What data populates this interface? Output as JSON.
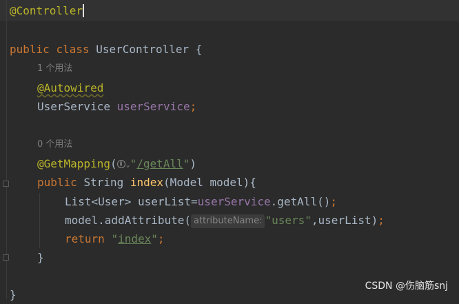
{
  "code": {
    "l1_annotation": "@Controller",
    "l3_public": "public",
    "l3_class": "class",
    "l3_name": "UserController",
    "l3_brace": "{",
    "usage_hint_1": "1 个用法",
    "l5_annotation": "@Autowired",
    "l6_type": "UserService",
    "l6_field": "userService",
    "l6_semi": ";",
    "usage_hint_2": "0 个用法",
    "l9_annotation": "@GetMapping",
    "l9_open": "(",
    "l9_quote_open": "\"",
    "l9_path": "/getAll",
    "l9_quote_close": "\"",
    "l9_close": ")",
    "l10_public": "public",
    "l10_type": "String",
    "l10_method": "index",
    "l10_params": "(Model model){",
    "l11_type": "List<User>",
    "l11_var": "userList=",
    "l11_field": "userService",
    "l11_call": ".getAll()",
    "l11_semi": ";",
    "l12_call": "model.addAttribute(",
    "l12_param_hint": "attributeName:",
    "l12_string": "\"users\"",
    "l12_rest": ",userList)",
    "l12_semi": ";",
    "l13_return": "return",
    "l13_quote_open": "\"",
    "l13_value": "index",
    "l13_quote_close": "\"",
    "l13_semi": ";",
    "l14_brace": "}",
    "l16_brace": "}"
  },
  "watermark": "CSDN @伤脑筋snj",
  "colors": {
    "background": "#2b2b2b",
    "keyword": "#cc7832",
    "annotation": "#bbb529",
    "field": "#9876aa",
    "method": "#ffc66d",
    "string": "#6a8759",
    "text": "#a9b7c6"
  }
}
